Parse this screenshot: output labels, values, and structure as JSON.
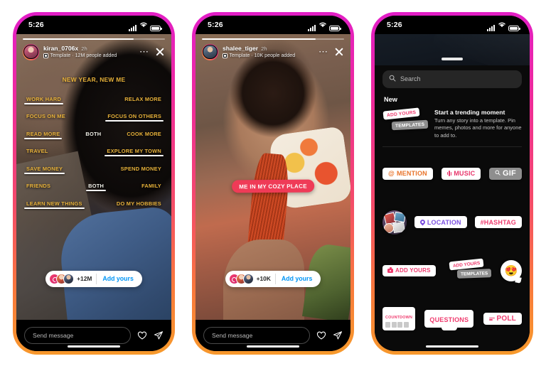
{
  "phones": [
    {
      "id": "story-template",
      "status": {
        "time": "5:26",
        "signal_icon": "cellular-signal-icon",
        "wifi_icon": "wifi-icon",
        "battery_icon": "battery-icon"
      },
      "story": {
        "username": "kiran_0706x",
        "timestamp": "2h",
        "template_badge_icon": "template-icon",
        "subtitle": "Template · 12M people added",
        "more_icon": "more-options-icon",
        "close_icon": "close-icon",
        "title": "NEW YEAR, NEW ME",
        "rows": [
          {
            "left": "WORK HARD",
            "left_selected": true,
            "right": "RELAX MORE",
            "right_selected": false
          },
          {
            "left": "FOCUS ON ME",
            "left_selected": false,
            "right": "FOCUS ON OTHERS",
            "right_selected": true
          },
          {
            "left": "READ MORE",
            "left_selected": true,
            "middle": "BOTH",
            "middle_selected": false,
            "right": "COOK MORE",
            "right_selected": false
          },
          {
            "left": "TRAVEL",
            "left_selected": false,
            "right": "EXPLORE MY TOWN",
            "right_selected": true
          },
          {
            "left": "SAVE MONEY",
            "left_selected": true,
            "right": "SPEND MONEY",
            "right_selected": false
          },
          {
            "left": "FRIENDS",
            "left_selected": false,
            "middle": "BOTH",
            "middle_selected": true,
            "right": "FAMILY",
            "right_selected": false
          },
          {
            "left": "LEARN NEW THINGS",
            "left_selected": true,
            "right": "DO MY HOBBIES",
            "right_selected": false
          }
        ],
        "add_yours": {
          "count": "+12M",
          "cta": "Add yours"
        },
        "footer": {
          "placeholder": "Send message",
          "like_icon": "heart-icon",
          "share_icon": "share-paper-plane-icon"
        }
      }
    },
    {
      "id": "story-response",
      "status": {
        "time": "5:26",
        "signal_icon": "cellular-signal-icon",
        "wifi_icon": "wifi-icon",
        "battery_icon": "battery-icon"
      },
      "story": {
        "username": "shalee_tiger",
        "timestamp": "2h",
        "template_badge_icon": "template-icon",
        "subtitle": "Template · 10K people added",
        "more_icon": "more-options-icon",
        "close_icon": "close-icon",
        "caption_pill": "ME IN MY COZY PLACE",
        "add_yours": {
          "count": "+10K",
          "cta": "Add yours"
        },
        "footer": {
          "placeholder": "Send message",
          "like_icon": "heart-icon",
          "share_icon": "share-paper-plane-icon"
        }
      }
    },
    {
      "id": "sticker-tray",
      "status": {
        "time": "5:26",
        "signal_icon": "cellular-signal-icon",
        "wifi_icon": "wifi-icon",
        "battery_icon": "battery-icon"
      },
      "tray": {
        "grabber_name": "sheet-grabber",
        "search": {
          "placeholder": "Search",
          "icon": "search-icon"
        },
        "section_label": "New",
        "promo": {
          "sticker_add_yours": "ADD YOURS",
          "sticker_templates": "TEMPLATES",
          "title": "Start a trending moment",
          "description": "Turn any story into a template. Pin memes, photos and more for anyone to add to."
        },
        "rows": [
          [
            {
              "type": "chip",
              "style": "mention",
              "icon": "at-mention-icon",
              "label": "MENTION"
            },
            {
              "type": "chip",
              "style": "music",
              "icon": "music-wave-icon",
              "label": "MUSIC"
            },
            {
              "type": "chip",
              "style": "gif",
              "icon": "search-icon",
              "label": "GIF"
            }
          ],
          [
            {
              "type": "collage",
              "name": "photo-collage-sticker"
            },
            {
              "type": "chip",
              "style": "location",
              "icon": "location-pin-icon",
              "label": "LOCATION"
            },
            {
              "type": "chip",
              "style": "hashtag",
              "label": "#HASHTAG"
            }
          ],
          [
            {
              "type": "chip",
              "style": "addyours",
              "icon": "camera-icon",
              "label": "ADD YOURS"
            },
            {
              "type": "combo",
              "top_label": "ADD YOURS",
              "bottom_label": "TEMPLATES"
            },
            {
              "type": "emoji",
              "glyph": "😍",
              "name": "heart-eyes-emoji-sticker"
            }
          ],
          [
            {
              "type": "countdown",
              "label": "COUNTDOWN"
            },
            {
              "type": "questions",
              "label": "QUESTIONS"
            },
            {
              "type": "chip",
              "style": "poll",
              "icon": "poll-bars-icon",
              "label": "POLL"
            }
          ]
        ]
      }
    }
  ],
  "colors": {
    "frame_top": "#e21ec8",
    "frame_bottom": "#f79a2b",
    "accent_blue": "#0095f6",
    "accent_pink": "#ef3b6e",
    "template_gold": "#e8b23a",
    "background": "#ffffff"
  }
}
